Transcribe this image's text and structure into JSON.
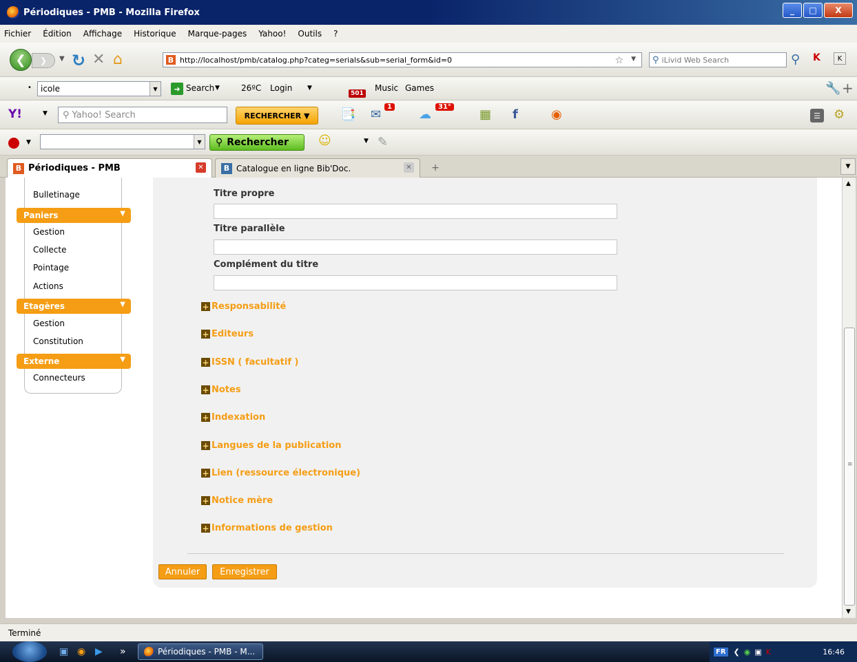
{
  "window": {
    "title": "Périodiques - PMB - Mozilla Firefox",
    "min": "_",
    "max": "□",
    "close": "X"
  },
  "menu": [
    "Fichier",
    "Édition",
    "Affichage",
    "Historique",
    "Marque-pages",
    "Yahoo!",
    "Outils",
    "?"
  ],
  "nav": {
    "url": "http://localhost/pmb/catalog.php?categ=serials&sub=serial_form&id=0",
    "site_icon": "B",
    "search_placeholder": "iLivid Web Search"
  },
  "toolbar2": {
    "combo_value": "icole",
    "search_label": "Search",
    "temp": "26ºC",
    "login": "Login",
    "badge": "501",
    "music": "Music",
    "games": "Games"
  },
  "yahoo_toolbar": {
    "search_placeholder": "Yahoo! Search",
    "button": "RECHERCHER",
    "mail_badge": "1",
    "weather_badge": "31°"
  },
  "toolbar4": {
    "button": "Rechercher"
  },
  "tabs": [
    {
      "label": "Périodiques - PMB",
      "icon": "B",
      "active": true
    },
    {
      "label": "Catalogue en ligne Bib'Doc.",
      "icon": "B",
      "active": false
    }
  ],
  "sidebar": {
    "top_item": "Bulletinage",
    "groups": [
      {
        "title": "Paniers",
        "items": [
          "Gestion",
          "Collecte",
          "Pointage",
          "Actions"
        ]
      },
      {
        "title": "Etagères",
        "items": [
          "Gestion",
          "Constitution"
        ]
      },
      {
        "title": "Externe",
        "items": [
          "Connecteurs"
        ]
      }
    ]
  },
  "form": {
    "fields": [
      {
        "label": "Titre propre",
        "value": ""
      },
      {
        "label": "Titre parallèle",
        "value": ""
      },
      {
        "label": "Complément du titre",
        "value": ""
      }
    ],
    "sections": [
      "Responsabilité",
      "Editeurs",
      "ISSN ( facultatif )",
      "Notes",
      "Indexation",
      "Langues de la publication",
      "Lien (ressource électronique)",
      "Notice mère",
      "Informations de gestion"
    ],
    "cancel": "Annuler",
    "save": "Enregistrer"
  },
  "status": "Terminé",
  "taskbar": {
    "window_button": "Périodiques - PMB - M...",
    "lang": "FR",
    "clock": "16:46",
    "more": "»"
  },
  "colors": {
    "accent": "#f59d14",
    "titlebar": "#0a246a"
  }
}
